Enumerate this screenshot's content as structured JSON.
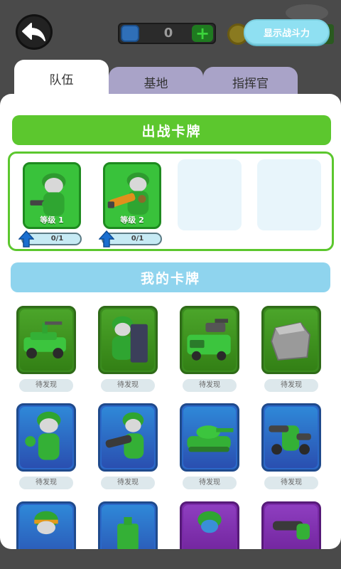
{
  "topbar": {
    "back_icon": "back-arrow-icon",
    "currency_value": "0",
    "currency_add_icon": "plus-icon",
    "power_button_label": "显示战斗力"
  },
  "tabs": [
    {
      "label": "队伍",
      "active": true
    },
    {
      "label": "基地",
      "active": false
    },
    {
      "label": "指挥官",
      "active": false
    }
  ],
  "sections": {
    "battle_cards_title": "出战卡牌",
    "my_cards_title": "我的卡牌"
  },
  "team_slots": [
    {
      "level": "等级 1",
      "progress": "0/1",
      "icon": "soldier-pistol-icon"
    },
    {
      "level": "等级 2",
      "progress": "0/1",
      "icon": "soldier-bazooka-icon"
    }
  ],
  "my_cards": [
    {
      "icon": "jeep-icon",
      "status": "待发现",
      "color": "green"
    },
    {
      "icon": "shield-soldier-icon",
      "status": "待发现",
      "color": "green"
    },
    {
      "icon": "rocket-truck-icon",
      "status": "待发现",
      "color": "green"
    },
    {
      "icon": "rock-block-icon",
      "status": "待发现",
      "color": "green"
    },
    {
      "icon": "soldier-waving-icon",
      "status": "待发现",
      "color": "blue"
    },
    {
      "icon": "bazooka-soldier-icon",
      "status": "待发现",
      "color": "blue"
    },
    {
      "icon": "tank-icon",
      "status": "待发现",
      "color": "blue"
    },
    {
      "icon": "cannon-robot-icon",
      "status": "待发现",
      "color": "blue"
    },
    {
      "icon": "soldier-helmet-icon",
      "status": "",
      "color": "blue"
    },
    {
      "icon": "turret-icon",
      "status": "",
      "color": "blue"
    },
    {
      "icon": "soldier-purple-icon",
      "status": "",
      "color": "purple"
    },
    {
      "icon": "cannon-icon",
      "status": "",
      "color": "purple"
    }
  ],
  "colors": {
    "green_header": "#5cc72e",
    "blue_header": "#8fd4ee",
    "tab_inactive": "#a9a3c8",
    "power_button": "#8fe0f2"
  }
}
